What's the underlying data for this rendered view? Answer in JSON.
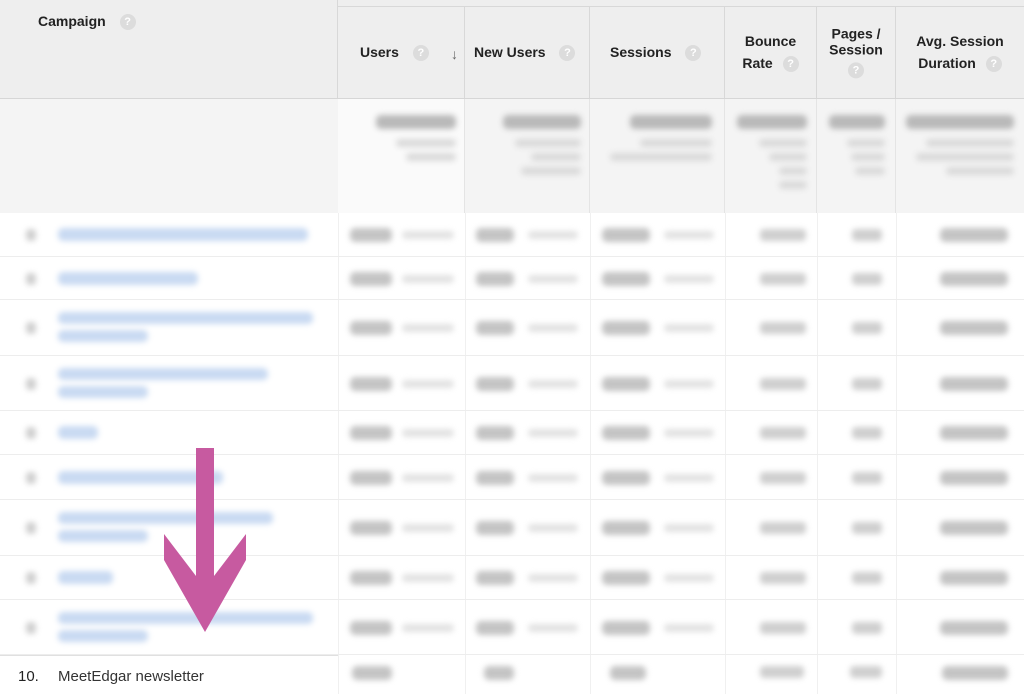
{
  "header": {
    "campaign": "Campaign",
    "users": "Users",
    "new_users": "New Users",
    "sessions": "Sessions",
    "bounce_rate_line1": "Bounce",
    "bounce_rate_line2": "Rate",
    "pages_session_line1": "Pages /",
    "pages_session_line2": "Session",
    "avg_duration_line1": "Avg. Session",
    "avg_duration_line2": "Duration",
    "help_glyph": "?",
    "sort_glyph": "↓"
  },
  "rows": [
    {
      "rank": "10.",
      "label": "MeetEdgar newsletter"
    }
  ],
  "colors": {
    "header_bg": "#eeeeee",
    "link_blur": "#c9daf2",
    "arrow": "#c75aa0"
  },
  "icons": {
    "help": "help-circle-icon",
    "sort": "sort-down-icon",
    "annotation": "arrow-down-icon"
  }
}
